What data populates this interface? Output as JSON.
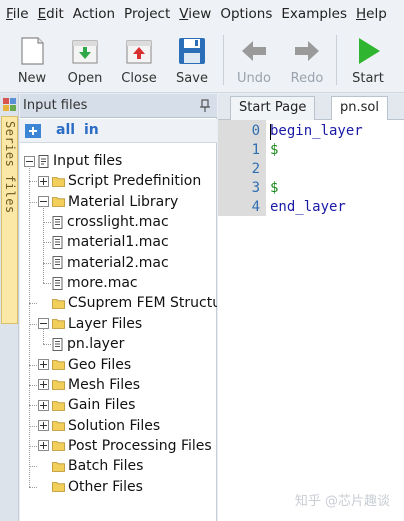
{
  "menubar": {
    "items": [
      {
        "underline": "F",
        "rest": "ile"
      },
      {
        "underline": "E",
        "rest": "dit"
      },
      {
        "underline": "",
        "rest": "Action"
      },
      {
        "underline": "",
        "rest": "Project"
      },
      {
        "underline": "V",
        "rest": "iew"
      },
      {
        "underline": "",
        "rest": "Options"
      },
      {
        "underline": "",
        "rest": "Examples"
      },
      {
        "underline": "H",
        "rest": "elp"
      }
    ]
  },
  "toolbar": {
    "new": "New",
    "open": "Open",
    "close": "Close",
    "save": "Save",
    "undo": "Undo",
    "redo": "Redo",
    "start": "Start"
  },
  "dock": {
    "series_tab": "Series files"
  },
  "panel": {
    "title": "Input files",
    "tool_all": "all",
    "tool_in": "in"
  },
  "tree": {
    "root": "Input files",
    "items": [
      {
        "label": "Script Predefinition",
        "expander": "plus"
      },
      {
        "label": "Material Library",
        "expander": "minus"
      },
      {
        "label": "crosslight.mac"
      },
      {
        "label": "material1.mac"
      },
      {
        "label": "material2.mac"
      },
      {
        "label": "more.mac"
      },
      {
        "label": "CSuprem FEM Structu",
        "expander": "none"
      },
      {
        "label": "Layer Files",
        "expander": "minus"
      },
      {
        "label": "pn.layer"
      },
      {
        "label": "Geo Files",
        "expander": "plus"
      },
      {
        "label": "Mesh Files",
        "expander": "plus"
      },
      {
        "label": "Gain Files",
        "expander": "plus"
      },
      {
        "label": "Solution Files",
        "expander": "plus"
      },
      {
        "label": "Post Processing Files",
        "expander": "plus"
      },
      {
        "label": "Batch Files",
        "expander": "none"
      },
      {
        "label": "Other Files",
        "expander": "none"
      }
    ]
  },
  "editor": {
    "tabs": [
      "Start Page",
      "pn.sol"
    ],
    "lines": [
      {
        "n": "0",
        "text": "begin_layer"
      },
      {
        "n": "1",
        "text": "$"
      },
      {
        "n": "2",
        "text": ""
      },
      {
        "n": "3",
        "text": "$"
      },
      {
        "n": "4",
        "text": "end_layer"
      }
    ]
  },
  "watermark": "知乎 @芯片趣谈",
  "colors": {
    "menubar_bg": "#eef1f5",
    "panel_header_bg": "#d6dfe9",
    "series_tab_bg": "#fbe7a6",
    "code_blue": "#1a1aa6",
    "code_green": "#1a8a1a",
    "start_green": "#2fb52f",
    "save_blue": "#2a6fb8"
  }
}
